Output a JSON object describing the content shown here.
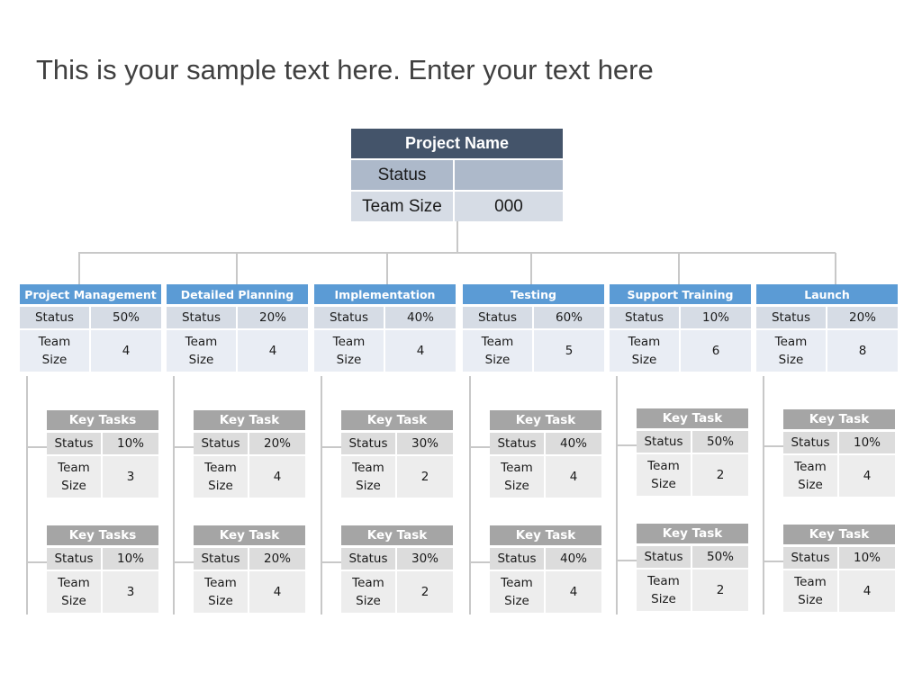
{
  "title": "This is your sample text here. Enter your text here",
  "colors": {
    "root_header": "#44546a",
    "phase_header": "#5b9bd5",
    "task_header": "#a5a5a5",
    "connector": "#c8c8c8"
  },
  "root": {
    "name": "Project Name",
    "status_label": "Status",
    "status_value": "",
    "team_label": "Team Size",
    "team_value": "000"
  },
  "labels": {
    "status": "Status",
    "team_line1": "Team",
    "team_line2": "Size"
  },
  "phases": [
    {
      "name": "Project Management",
      "status": "50%",
      "team": "4",
      "tasks": [
        {
          "name": "Key Tasks",
          "status": "10%",
          "team": "3"
        },
        {
          "name": "Key Tasks",
          "status": "10%",
          "team": "3"
        }
      ]
    },
    {
      "name": "Detailed Planning",
      "status": "20%",
      "team": "4",
      "tasks": [
        {
          "name": "Key Task",
          "status": "20%",
          "team": "4"
        },
        {
          "name": "Key Task",
          "status": "20%",
          "team": "4"
        }
      ]
    },
    {
      "name": "Implementation",
      "status": "40%",
      "team": "4",
      "tasks": [
        {
          "name": "Key Task",
          "status": "30%",
          "team": "2"
        },
        {
          "name": "Key Task",
          "status": "30%",
          "team": "2"
        }
      ]
    },
    {
      "name": "Testing",
      "status": "60%",
      "team": "5",
      "tasks": [
        {
          "name": "Key Task",
          "status": "40%",
          "team": "4"
        },
        {
          "name": "Key Task",
          "status": "40%",
          "team": "4"
        }
      ]
    },
    {
      "name": "Support Training",
      "status": "10%",
      "team": "6",
      "tasks": [
        {
          "name": "Key Task",
          "status": "50%",
          "team": "2"
        },
        {
          "name": "Key Task",
          "status": "50%",
          "team": "2"
        }
      ]
    },
    {
      "name": "Launch",
      "status": "20%",
      "team": "8",
      "tasks": [
        {
          "name": "Key Task",
          "status": "10%",
          "team": "4"
        },
        {
          "name": "Key Task",
          "status": "10%",
          "team": "4"
        }
      ]
    }
  ]
}
